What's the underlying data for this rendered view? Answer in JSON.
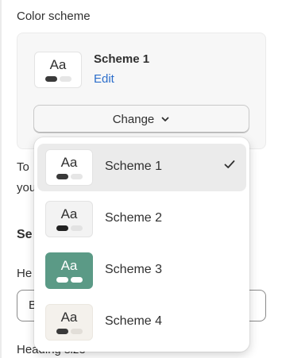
{
  "color_scheme": {
    "section_label": "Color scheme",
    "current": {
      "swatch_text": "Aa",
      "name": "Scheme 1",
      "edit_label": "Edit"
    },
    "change_label": "Change"
  },
  "background": {
    "para_line1": "To",
    "para_line2": "you",
    "section_heading": "Se",
    "field_label": "He",
    "input_value": "B",
    "heading_size_label": "Heading size"
  },
  "dropdown": {
    "selected_index": 0,
    "options": [
      {
        "label": "Scheme 1",
        "swatch_text": "Aa",
        "bg": "#ffffff",
        "text": "#303030",
        "pill1": "#3a3a3a",
        "pill2": "#e6e6e6",
        "border": "#e3e3e3"
      },
      {
        "label": "Scheme 2",
        "swatch_text": "Aa",
        "bg": "#f3f3f3",
        "text": "#303030",
        "pill1": "#222222",
        "pill2": "#e2e2e2",
        "border": "#e3e3e3"
      },
      {
        "label": "Scheme 3",
        "swatch_text": "Aa",
        "bg": "#5b9a86",
        "text": "#ffffff",
        "pill1": "#ffffff",
        "pill2": "#ffffff",
        "border": "#5b9a86"
      },
      {
        "label": "Scheme 4",
        "swatch_text": "Aa",
        "bg": "#f4f1ec",
        "text": "#303030",
        "pill1": "#3a3a3a",
        "pill2": "#e2ded8",
        "border": "#ebe7e0"
      }
    ]
  },
  "icons": {
    "change": "chevron-down-icon",
    "selected": "checkmark-icon"
  }
}
